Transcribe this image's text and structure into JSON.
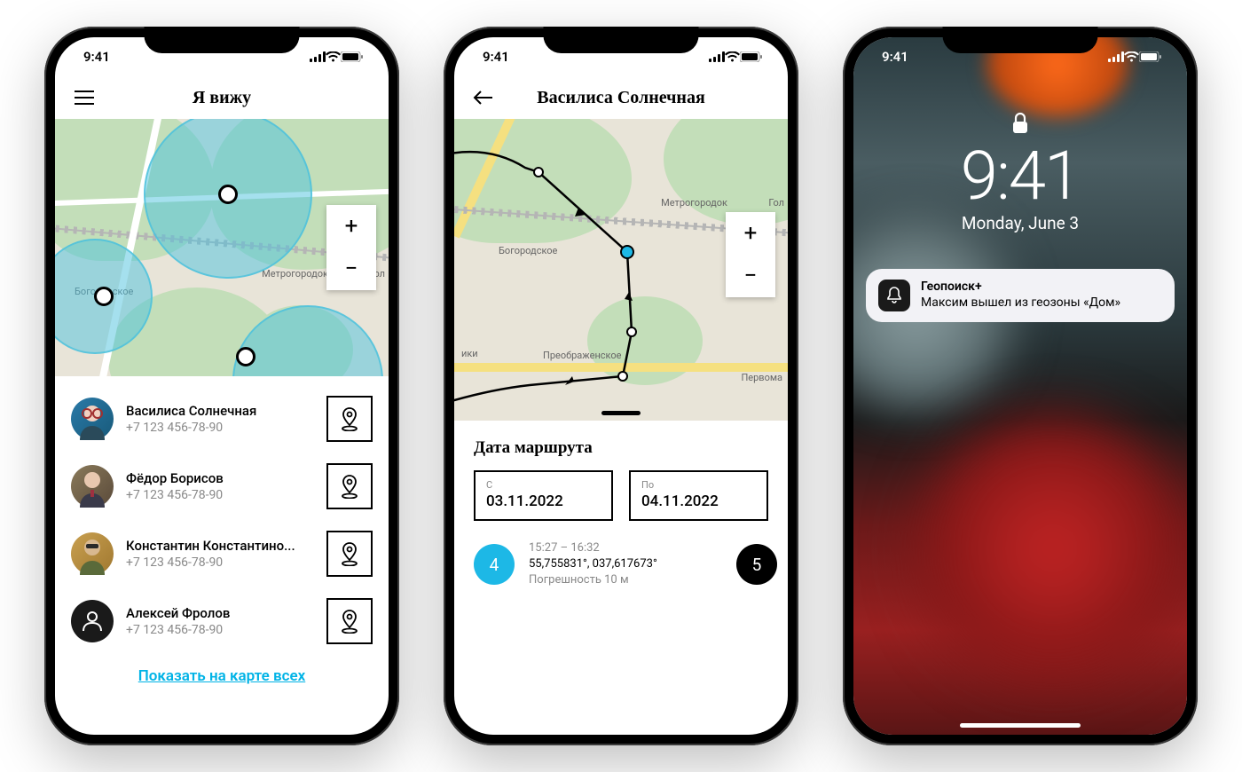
{
  "status_time": "9:41",
  "screen1": {
    "title": "Я вижу",
    "map_labels": {
      "bogorodskoe": "Богородское",
      "metrogorodok": "Метрогородок",
      "gol": "Гол"
    },
    "zoom_in": "+",
    "zoom_out": "−",
    "contacts": [
      {
        "name": "Василиса Солнечная",
        "phone": "+7 123 456-78-90"
      },
      {
        "name": "Фёдор Борисов",
        "phone": "+7 123 456-78-90"
      },
      {
        "name": "Константин Константино...",
        "phone": "+7 123 456-78-90"
      },
      {
        "name": "Алексей Фролов",
        "phone": "+7 123 456-78-90"
      }
    ],
    "show_all": "Показать на карте всех"
  },
  "screen2": {
    "title": "Василиса Солнечная",
    "map_labels": {
      "bogorodskoe": "Богородское",
      "metrogorodok": "Метрогородок",
      "gol": "Гол",
      "preobrazhenskoe": "Преображенское",
      "pervoma": "Первома",
      "iki": "ики"
    },
    "zoom_in": "+",
    "zoom_out": "−",
    "panel_title": "Дата маршрута",
    "date_from_label": "С",
    "date_from_value": "03.11.2022",
    "date_to_label": "По",
    "date_to_value": "04.11.2022",
    "waypoint": {
      "index": "4",
      "next_index": "5",
      "time": "15:27 – 16:32",
      "coords": "55,755831°, 037,617673°",
      "accuracy": "Погрешность 10 м"
    }
  },
  "screen3": {
    "time": "9:41",
    "date": "Monday, June 3",
    "notification": {
      "app": "Геопоиск+",
      "body": "Максим вышел из геозоны «Дом»"
    }
  }
}
